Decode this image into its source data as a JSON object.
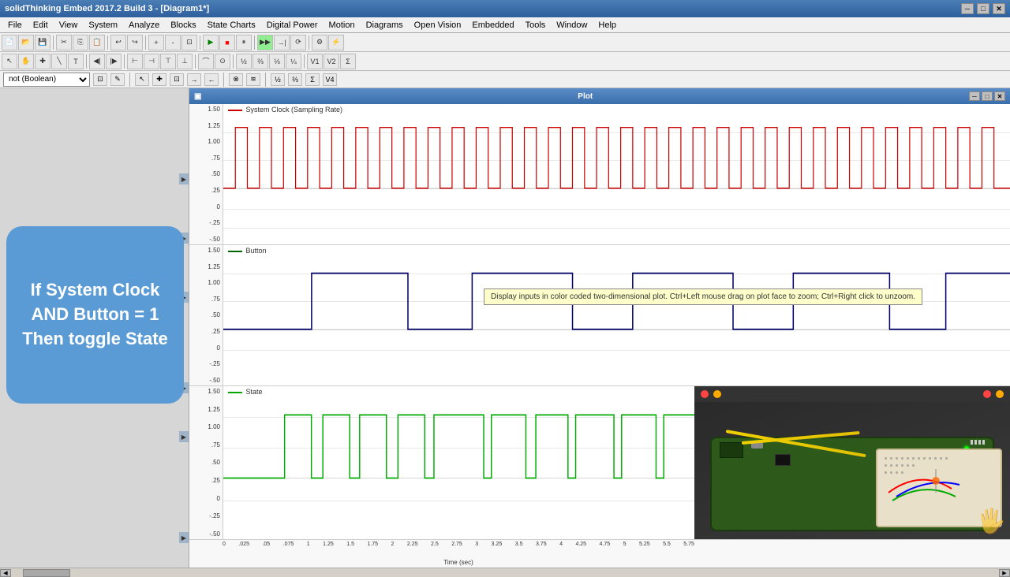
{
  "app": {
    "title": "solidThinking Embed 2017.2 Build 3 - [Diagram1*]"
  },
  "menu": {
    "items": [
      "File",
      "Edit",
      "View",
      "System",
      "Analyze",
      "Blocks",
      "State Charts",
      "Digital Power",
      "Motion",
      "Diagrams",
      "Open Vision",
      "Embedded",
      "Tools",
      "Window",
      "Help"
    ]
  },
  "title_controls": {
    "minimize": "─",
    "restore": "□",
    "close": "✕"
  },
  "plot_window": {
    "title": "Plot",
    "controls": {
      "minimize": "─",
      "restore": "□",
      "close": "✕"
    }
  },
  "dropdown_bar": {
    "value": "not (Boolean)"
  },
  "info_box": {
    "text": "If System Clock AND Button = 1 Then toggle State"
  },
  "charts": {
    "clock": {
      "label": "System Clock (Sampling Rate)",
      "color": "#cc0000",
      "y_axis": [
        "1.50",
        "1.25",
        "1.00",
        ".75",
        ".50",
        ".25",
        "0",
        "-.25",
        "-.50"
      ]
    },
    "button": {
      "label": "Button",
      "color": "#006600",
      "y_axis": [
        "1.50",
        "1.25",
        "1.00",
        ".75",
        ".50",
        ".25",
        "0",
        "-.25",
        "-.50"
      ]
    },
    "state": {
      "label": "State",
      "color": "#00aa00",
      "y_axis": [
        "1.50",
        "1.25",
        "1.00",
        ".75",
        ".50",
        ".25",
        "0",
        "-.25",
        "-.50"
      ]
    }
  },
  "tooltip": {
    "text": "Display inputs in color coded two-dimensional plot. Ctrl+Left mouse drag on plot face to zoom; Ctrl+Right click to unzoom."
  },
  "time_axis": {
    "label": "Time (sec)",
    "ticks": [
      "0",
      ".025",
      ".05",
      ".075",
      "1",
      "1.25",
      "1.5",
      "1.75",
      "2",
      "2.25",
      "2.5",
      "2.75",
      "3",
      "3.25",
      "3.5",
      "3.75",
      "4",
      "4.25",
      "4.75",
      "5",
      "5.25",
      "5.5",
      "5.75"
    ]
  },
  "sidebar_arrows": {
    "positions": [
      115,
      190,
      265,
      380,
      440,
      570
    ]
  }
}
